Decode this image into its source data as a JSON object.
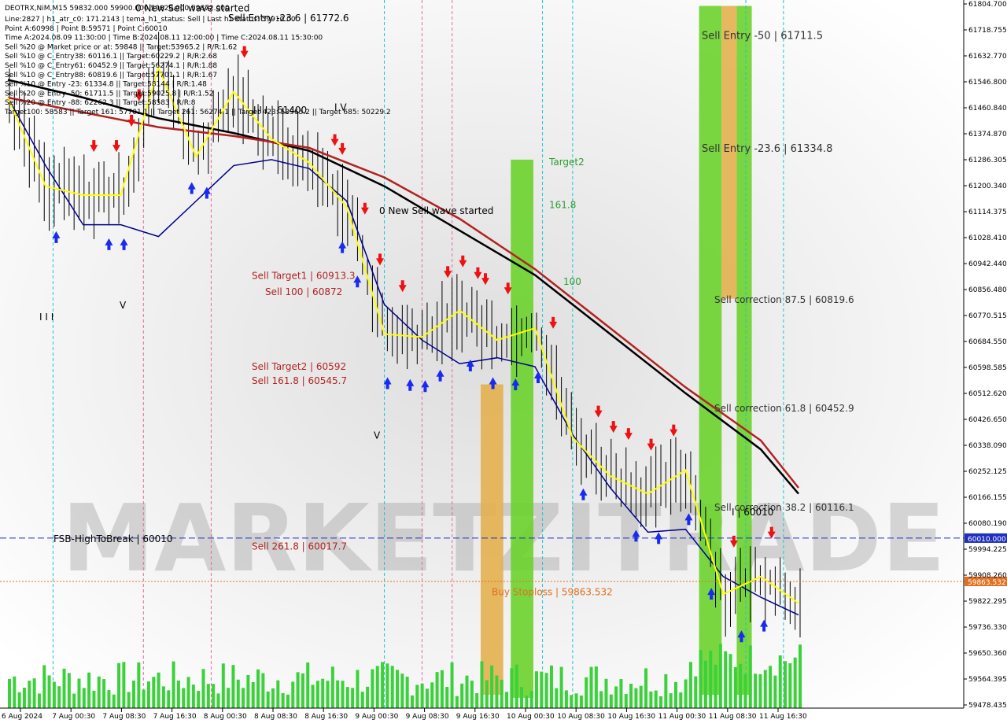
{
  "window": {
    "title": "DEOTRX,NiM,M15  59832.000 59900.000 59820.000 59872.000",
    "info_lines": [
      "Line:2827 | h1_atr_c0: 171.2143 | tema_h1_status: Sell | Last h1 status: 59910.00",
      "Point A:60998 | Point B:59571 | Point C:60010",
      "Time A:2024.08.09 11:30:00 | Time B:2024.08.11 12:00:00 | Time C:2024.08.11 15:30:00",
      "Sell %20 @ Market price or at: 59848 || Target:53965.2 | R/R:1.62",
      "Sell %10 @ C_Entry38: 60116.1 || Target:60229.2 | R/R:2.68",
      "Sell %10 @ C_Entry61: 60452.9 || Target:56274.1 | R/R:1.88",
      "Sell %10 @ C_Entry88: 60819.6 || Target:57701.1 | R/R:1.67",
      "Sell %10 @ Entry -23: 61334.8 || Target:58144 | R/R:1.48",
      "Sell %20 @ Entry -50: 61711.5 || Target:59025.8 | R/R:1.52",
      "Sell %20 @ Entry -88: 62262.3 || Target:58583 | R/R:8",
      "Target100: 58583 || Target 161: 57701.1 || Target 261: 56274.1 || Target 423: 53965.2 || Target 685: 50229.2"
    ]
  },
  "watermark": "MARKETZITRADE",
  "price_levels": {
    "hline_blue_label": "60010.000",
    "hline_red_label": "59863.532"
  },
  "annotations": [
    {
      "text": "0 New Sell wave started",
      "color": "#000000",
      "price": 61805,
      "time": "6 Aug 21:00"
    },
    {
      "text": "Sell Entry -23.6 | 61772.6",
      "color": "#000000",
      "price": 61772,
      "time": "7 Aug 14:00"
    },
    {
      "text": "I I I | 61400",
      "color": "#000000",
      "price": 61460,
      "time": "8 Aug 00:00"
    },
    {
      "text": "I V",
      "color": "#000000",
      "price": 61470,
      "time": "8 Aug 19:00"
    },
    {
      "text": "Sell Entry -50 | 61711.5",
      "color": "#333333",
      "price": 61711,
      "time": "11 Aug 08:00"
    },
    {
      "text": "Sell Entry -23.6 | 61334.8",
      "color": "#333333",
      "price": 61330,
      "time": "11 Aug 08:00"
    },
    {
      "text": "Sell correction 87.5 | 60819.6",
      "color": "#333333",
      "price": 60819,
      "time": "11 Aug 08:00"
    },
    {
      "text": "Sell correction 61.8 | 60452.9",
      "color": "#333333",
      "price": 60452,
      "time": "11 Aug 08:00"
    },
    {
      "text": "Sell correction 38.2 | 60116.1",
      "color": "#333333",
      "price": 60116,
      "time": "11 Aug 08:00"
    },
    {
      "text": "Target2",
      "color": "#2e9e2e",
      "price": 61285,
      "time": "10 Aug 13:00"
    },
    {
      "text": "161.8",
      "color": "#2e9e2e",
      "price": 61140,
      "time": "10 Aug 13:00"
    },
    {
      "text": "100",
      "color": "#2e9e2e",
      "price": 60880,
      "time": "10 Aug 15:00"
    },
    {
      "text": "0 New Sell wave started",
      "color": "#000000",
      "price": 61120,
      "time": "9 Aug 10:30"
    },
    {
      "text": "Sell Target1 | 60913.3",
      "color": "#b22222",
      "price": 60900,
      "time": "8 Aug 07:00"
    },
    {
      "text": "Sell 100 | 60872",
      "color": "#b22222",
      "price": 60845,
      "time": "8 Aug 11:00"
    },
    {
      "text": "Sell Target2 | 60592",
      "color": "#b22222",
      "price": 60592,
      "time": "8 Aug 08:00"
    },
    {
      "text": "Sell 161.8 | 60545.7",
      "color": "#b22222",
      "price": 60545,
      "time": "8 Aug 08:00"
    },
    {
      "text": "Sell 261.8 | 60017.7",
      "color": "#b22222",
      "price": 59985,
      "time": "8 Aug 08:00"
    },
    {
      "text": "FSB-HighToBreak | 60010",
      "color": "#000000",
      "price": 60010,
      "time": "6 Aug 03:00"
    },
    {
      "text": "Buy Stoploss | 59863.532",
      "color": "#e07020",
      "price": 59830,
      "time": "10 Aug 00:00"
    },
    {
      "text": "I I I",
      "color": "#000000",
      "price": 60760,
      "time": "6 Aug 09:00"
    },
    {
      "text": "V",
      "color": "#000000",
      "price": 60800,
      "time": "7 Aug 11:00"
    },
    {
      "text": "V",
      "color": "#000000",
      "price": 60360,
      "time": "9 Aug 09:30"
    },
    {
      "text": "I | 60010",
      "color": "#000000",
      "price": 60100,
      "time": "11 Aug 10:00"
    }
  ],
  "chart_data": {
    "type": "line",
    "title": "",
    "xlabel": "",
    "ylabel": "",
    "ylim": [
      59435,
      61830
    ],
    "y_ticks": [
      "61804.700",
      "61718.755",
      "61632.770",
      "61546.800",
      "61460.840",
      "61374.870",
      "61286.305",
      "61200.340",
      "61114.375",
      "61028.410",
      "60942.440",
      "60856.480",
      "60770.515",
      "60684.550",
      "60598.585",
      "60512.620",
      "60426.650",
      "60338.090",
      "60252.125",
      "60166.155",
      "60080.190",
      "59994.225",
      "59908.260",
      "59822.295",
      "59736.330",
      "59650.360",
      "59564.395",
      "59478.435"
    ],
    "x_ticks": [
      "6 Aug 2024",
      "7 Aug 00:30",
      "7 Aug 08:30",
      "7 Aug 16:30",
      "8 Aug 00:30",
      "8 Aug 08:30",
      "8 Aug 16:30",
      "9 Aug 00:30",
      "9 Aug 08:30",
      "9 Aug 16:30",
      "10 Aug 00:30",
      "10 Aug 08:30",
      "10 Aug 16:30",
      "11 Aug 00:30",
      "11 Aug 08:30",
      "11 Aug 16:30"
    ],
    "x_count": 160,
    "series": [
      {
        "color": "#000000",
        "style": "solid",
        "width": 2.5,
        "points": [
          [
            0,
            61560
          ],
          [
            10,
            61500
          ],
          [
            20,
            61430
          ],
          [
            30,
            61380
          ],
          [
            40,
            61320
          ],
          [
            50,
            61200
          ],
          [
            60,
            61050
          ],
          [
            70,
            60900
          ],
          [
            80,
            60700
          ],
          [
            90,
            60500
          ],
          [
            100,
            60310
          ],
          [
            105,
            60160
          ]
        ]
      },
      {
        "color": "#b22222",
        "style": "solid",
        "width": 2.5,
        "points": [
          [
            0,
            61500
          ],
          [
            10,
            61450
          ],
          [
            20,
            61400
          ],
          [
            30,
            61370
          ],
          [
            40,
            61330
          ],
          [
            50,
            61230
          ],
          [
            60,
            61090
          ],
          [
            70,
            60920
          ],
          [
            80,
            60720
          ],
          [
            90,
            60520
          ],
          [
            100,
            60340
          ],
          [
            105,
            60180
          ]
        ]
      },
      {
        "color": "#00008b",
        "style": "solid",
        "width": 1.5,
        "points": [
          [
            0,
            61500
          ],
          [
            5,
            61270
          ],
          [
            10,
            61070
          ],
          [
            15,
            61070
          ],
          [
            20,
            61030
          ],
          [
            25,
            61150
          ],
          [
            30,
            61270
          ],
          [
            35,
            61290
          ],
          [
            40,
            61260
          ],
          [
            45,
            61150
          ],
          [
            50,
            60800
          ],
          [
            55,
            60680
          ],
          [
            60,
            60600
          ],
          [
            65,
            60620
          ],
          [
            70,
            60590
          ],
          [
            75,
            60360
          ],
          [
            80,
            60180
          ],
          [
            85,
            60030
          ],
          [
            90,
            60040
          ],
          [
            95,
            59880
          ],
          [
            100,
            59810
          ],
          [
            105,
            59750
          ]
        ]
      },
      {
        "color": "#ffff00",
        "style": "solid",
        "width": 2,
        "points": [
          [
            0,
            61500
          ],
          [
            5,
            61200
          ],
          [
            10,
            61170
          ],
          [
            15,
            61170
          ],
          [
            20,
            61600
          ],
          [
            25,
            61300
          ],
          [
            30,
            61520
          ],
          [
            35,
            61360
          ],
          [
            40,
            61280
          ],
          [
            45,
            61130
          ],
          [
            50,
            60700
          ],
          [
            55,
            60690
          ],
          [
            60,
            60780
          ],
          [
            65,
            60680
          ],
          [
            70,
            60720
          ],
          [
            75,
            60350
          ],
          [
            80,
            60220
          ],
          [
            85,
            60160
          ],
          [
            90,
            60240
          ],
          [
            95,
            59820
          ],
          [
            100,
            59880
          ],
          [
            105,
            59790
          ]
        ]
      }
    ],
    "vertical_lines": {
      "cyan": [
        6,
        50,
        71,
        75,
        98,
        103
      ],
      "magenta": [
        18,
        27,
        55,
        59
      ]
    },
    "zones": [
      {
        "color": "#6bd32c",
        "from_price": 61290,
        "to_price": 59470,
        "x0": 67,
        "x1": 70
      },
      {
        "color": "#e3b04f",
        "from_price": 60530,
        "to_price": 59480,
        "x0": 63,
        "x1": 66
      },
      {
        "color": "#6bd32c",
        "from_price": 61810,
        "to_price": 59480,
        "x0": 92,
        "x1": 95
      },
      {
        "color": "#e3b04f",
        "from_price": 61810,
        "to_price": 60820,
        "x0": 95,
        "x1": 97
      },
      {
        "color": "#6bd32c",
        "from_price": 61810,
        "to_price": 59480,
        "x0": 97,
        "x1": 99
      }
    ],
    "hline_blue": 60010,
    "hline_red": 59863.532,
    "volume_max": 120
  }
}
